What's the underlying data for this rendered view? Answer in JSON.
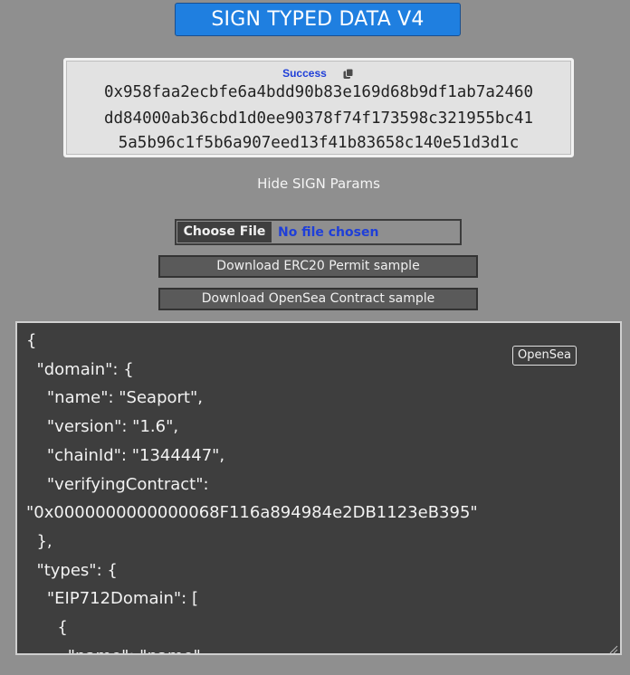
{
  "header": {
    "title": "SIGN TYPED DATA V4"
  },
  "result": {
    "status": "Success",
    "copy_icon": "copy-icon",
    "signature_lines": [
      "0x958faa2ecbfe6a4bdd90b83e169d68b9df1ab7a2460",
      "dd84000ab36cbd1d0ee90378f74f173598c321955bc41",
      "5a5b96c1f5b6a907eed13f41b83658c140e51d3d1c"
    ]
  },
  "params_toggle": {
    "label": "Hide SIGN Params"
  },
  "file_input": {
    "button_label": "Choose File",
    "status": "No file chosen"
  },
  "downloads": {
    "erc20_label": "Download ERC20 Permit sample",
    "opensea_label": "Download OpenSea Contract sample"
  },
  "editor": {
    "badge": "OpenSea",
    "content": "{\n  \"domain\": {\n    \"name\": \"Seaport\",\n    \"version\": \"1.6\",\n    \"chainId\": \"1344447\",\n    \"verifyingContract\":\n\"0x0000000000000068F116a894984e2DB1123eB395\"\n  },\n  \"types\": {\n    \"EIP712Domain\": [\n      {\n        \"name\": \"name\","
  },
  "colors": {
    "background": "#8f8f8f",
    "title_button": "#1f7fe0",
    "success_text": "#1f3fd8",
    "editor_bg": "#3e3e3e"
  }
}
